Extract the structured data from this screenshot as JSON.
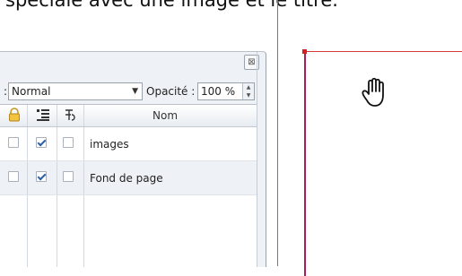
{
  "header_text": "spéciale avec une image et le titre.",
  "layers_panel": {
    "close_glyph": "⊠",
    "mode_prefix": ":",
    "blend_mode": "Normal",
    "dropdown_glyph": "▼",
    "opacity_label": "Opacité :",
    "opacity_value": "100 %",
    "columns": {
      "lock_icon": "lock-icon",
      "visible_icon": "layers-list-icon",
      "print_icon": "print-flow-icon",
      "name": "Nom"
    },
    "layers": [
      {
        "name": "images",
        "visible": true,
        "print": false,
        "locked": false
      },
      {
        "name": "Fond de page",
        "visible": true,
        "print": false,
        "locked": false
      }
    ]
  },
  "canvas": {
    "tool_icon": "hand-icon",
    "accent_color": "#a4205a",
    "guide_color": "#e24a4a"
  }
}
